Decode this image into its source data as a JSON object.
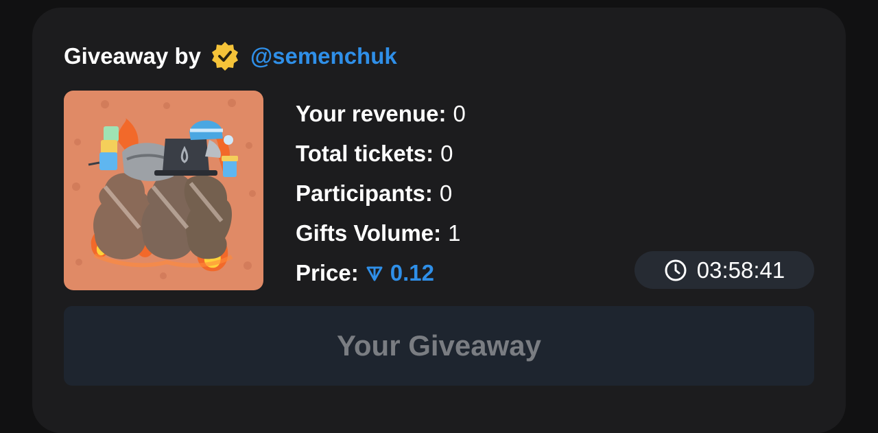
{
  "header": {
    "title_prefix": "Giveaway by",
    "verified_icon": "verified-badge-icon",
    "username": "@semenchuk",
    "colors": {
      "username": "#2f8fe8",
      "badge": "#f5c339"
    }
  },
  "prize_image": {
    "icon": "gift-sticker-image",
    "background": "#e08a66"
  },
  "stats": {
    "revenue": {
      "label": "Your revenue:",
      "value": "0"
    },
    "tickets": {
      "label": "Total tickets:",
      "value": "0"
    },
    "participants": {
      "label": "Participants:",
      "value": "0"
    },
    "gifts_volume": {
      "label": "Gifts Volume:",
      "value": "1"
    },
    "price": {
      "label": "Price:",
      "value": "0.12",
      "currency_icon": "ton-icon",
      "color": "#2f8fe8"
    }
  },
  "timer": {
    "icon": "clock-icon",
    "value": "03:58:41"
  },
  "action": {
    "label": "Your Giveaway"
  }
}
